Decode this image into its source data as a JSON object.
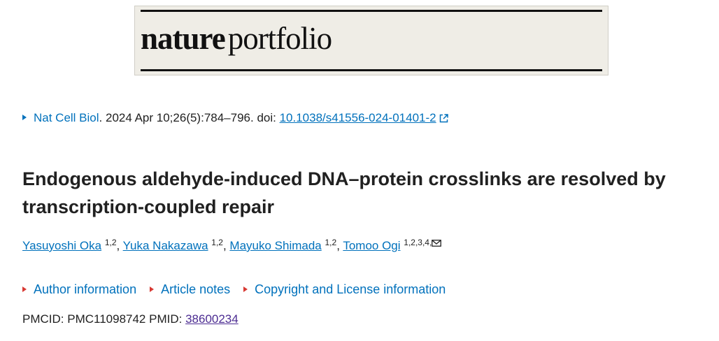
{
  "banner": {
    "logo_word1": "nature",
    "logo_word2": "portfolio"
  },
  "citation": {
    "journal": "Nat Cell Biol",
    "details": ". 2024 Apr 10;26(5):784–796. doi: ",
    "doi": "10.1038/s41556-024-01401-2"
  },
  "article": {
    "title": "Endogenous aldehyde-induced DNA–protein crosslinks are resolved by transcription-coupled repair"
  },
  "authors": [
    {
      "name": "Yasuyoshi Oka",
      "aff": "1,2"
    },
    {
      "name": "Yuka Nakazawa",
      "aff": "1,2"
    },
    {
      "name": "Mayuko Shimada",
      "aff": "1,2"
    },
    {
      "name": "Tomoo Ogi",
      "aff": "1,2,3,4,"
    }
  ],
  "accordions": {
    "author_info": "Author information",
    "article_notes": "Article notes",
    "copyright": "Copyright and License information"
  },
  "ids": {
    "pmcid_label": "PMCID: ",
    "pmcid": "PMC11098742",
    "pmid_label": "PMID: ",
    "pmid": "38600234"
  },
  "colors": {
    "link": "#0071bc",
    "visited_link": "#4c2c92",
    "accordion_marker": "#d83933",
    "banner_bg": "#efede6"
  }
}
